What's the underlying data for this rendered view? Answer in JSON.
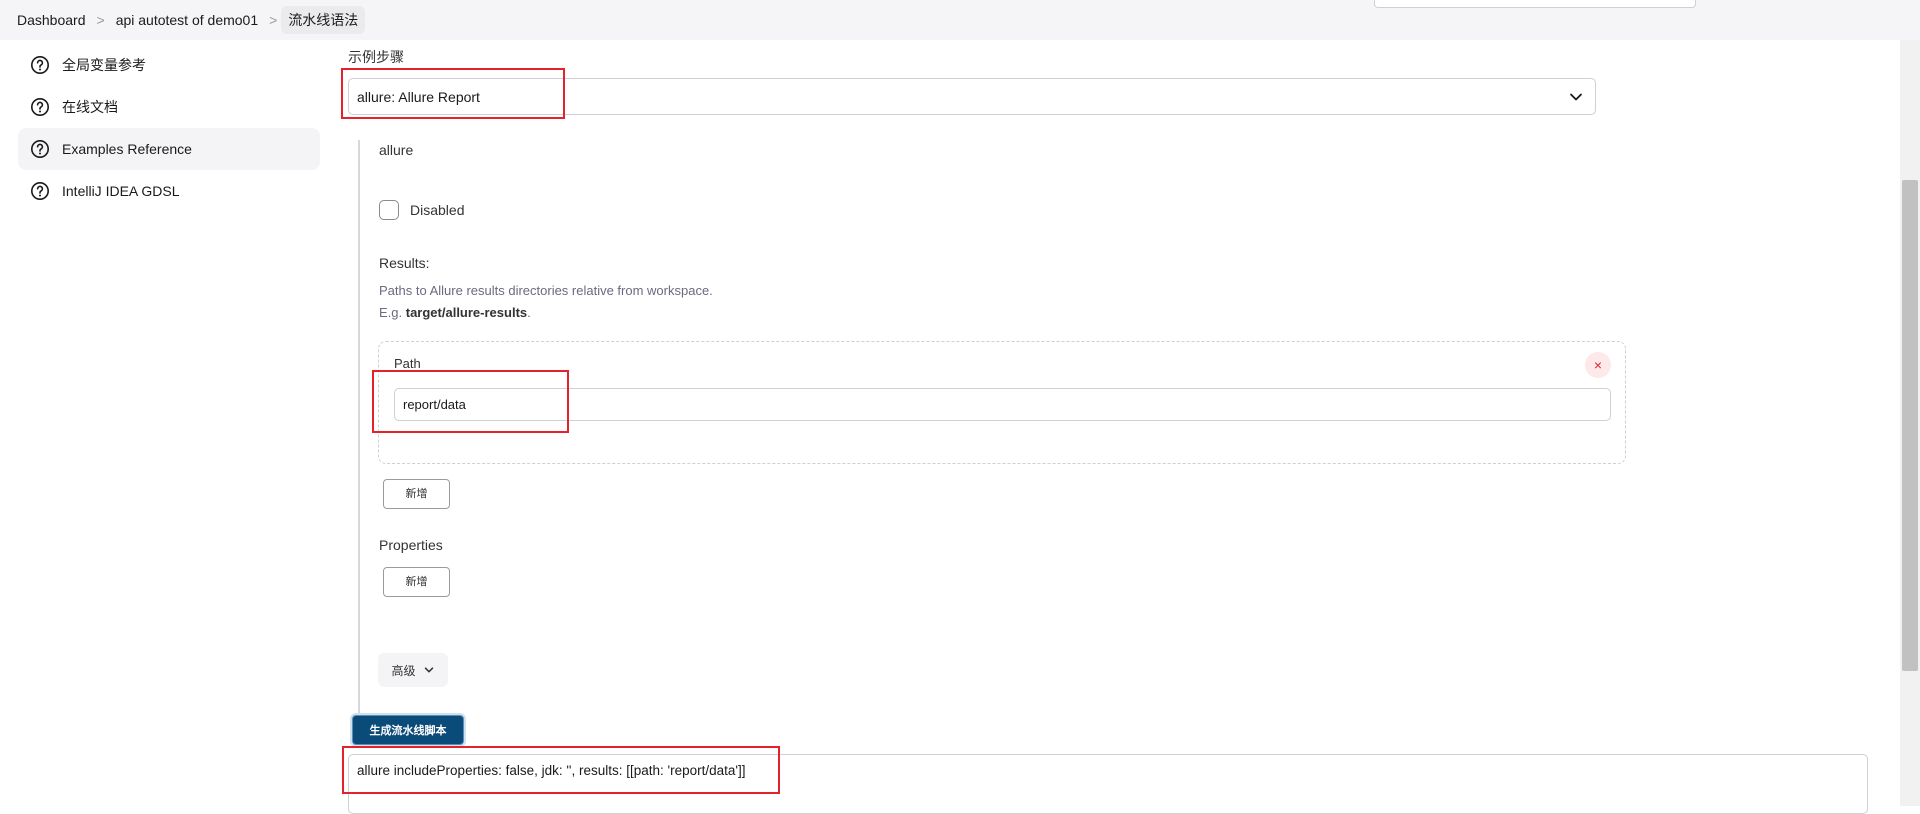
{
  "breadcrumb": {
    "items": [
      "Dashboard",
      "api autotest of demo01",
      "流水线语法"
    ],
    "separator": ">"
  },
  "sidebar": {
    "items": [
      {
        "label": "全局变量参考",
        "icon": "help-circle-icon"
      },
      {
        "label": "在线文档",
        "icon": "help-circle-icon"
      },
      {
        "label": "Examples Reference",
        "icon": "help-circle-icon",
        "active": true
      },
      {
        "label": "IntelliJ IDEA GDSL",
        "icon": "help-circle-icon"
      }
    ]
  },
  "main": {
    "sample_step_label": "示例步骤",
    "sample_step_value": "allure: Allure Report",
    "step_name": "allure",
    "disabled_label": "Disabled",
    "disabled_checked": false,
    "results_label": "Results:",
    "results_help_line1": "Paths to Allure results directories relative from workspace.",
    "results_help_prefix": "E.g. ",
    "results_help_example": "target/allure-results",
    "results_help_suffix": ".",
    "path_label": "Path",
    "path_value": "report/data",
    "delete_symbol": "×",
    "add_button_results": "新增",
    "properties_label": "Properties",
    "add_button_properties": "新增",
    "advanced_button": "高级",
    "generate_button": "生成流水线脚本",
    "generated_script": "allure includeProperties: false, jdk: '', results: [[path: 'report/data']]"
  },
  "colors": {
    "accent_button": "#0b4b7a",
    "annotation_red": "#e3222c",
    "delete_red": "#e0242e"
  }
}
